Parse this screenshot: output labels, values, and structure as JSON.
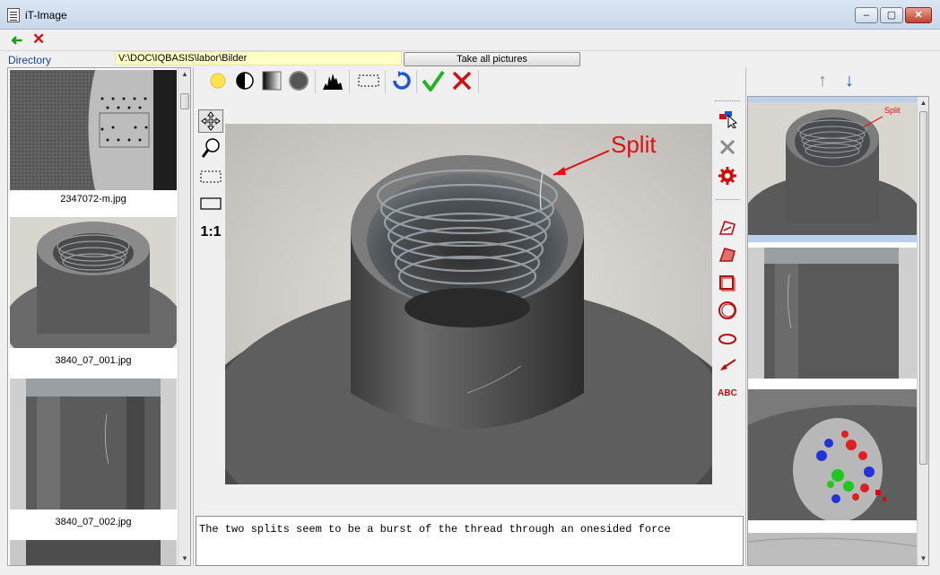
{
  "window": {
    "title": "iT-Image",
    "min": "–",
    "max": "▢",
    "close": "✕"
  },
  "toolbar": {
    "back": "➜",
    "cancel": "✕"
  },
  "directory": {
    "label": "Directory",
    "path": "V:\\DOC\\IQBASIS\\labor\\Bilder",
    "take_all_label": "Take all pictures"
  },
  "thumbnails": [
    {
      "label": "2347072-m.jpg"
    },
    {
      "label": "3840_07_001.jpg"
    },
    {
      "label": "3840_07_002.jpg"
    }
  ],
  "tools": {
    "one_to_one": "1:1",
    "text_tool": "ABC"
  },
  "annotation": {
    "label": "Split"
  },
  "right_thumb_annotation": "Split",
  "comment": "The two splits seem to be a burst of the thread through an onesided force",
  "colors": {
    "accent_blue": "#1a55d8",
    "ok_green": "#22b522",
    "cancel_red": "#d01010",
    "annotation_red": "#e01010"
  }
}
